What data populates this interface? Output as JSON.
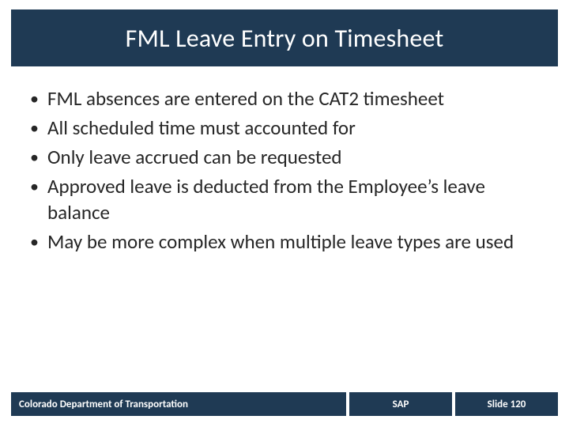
{
  "title": "FML Leave Entry on Timesheet",
  "bullets": [
    "FML absences are entered on the CAT2 timesheet",
    "All scheduled time must accounted for",
    "Only leave accrued can be requested",
    "Approved leave is deducted from the Employee’s leave balance",
    "May be more complex when multiple leave types are used"
  ],
  "footer": {
    "left": "Colorado Department of Transportation",
    "mid": "SAP",
    "right": "Slide 120"
  }
}
